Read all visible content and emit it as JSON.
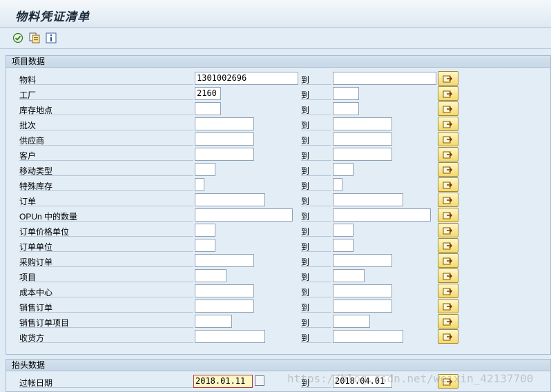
{
  "title": "物料凭证清单",
  "toolbar": {
    "execute": "execute-icon",
    "variants": "variants-icon",
    "info": "info-icon"
  },
  "item_group": {
    "title": "项目数据",
    "to_label": "到",
    "rows": [
      {
        "label": "物料",
        "from": "1301002696",
        "to": ""
      },
      {
        "label": "工厂",
        "from": "2160",
        "to": ""
      },
      {
        "label": "库存地点",
        "from": "",
        "to": ""
      },
      {
        "label": "批次",
        "from": "",
        "to": ""
      },
      {
        "label": "供应商",
        "from": "",
        "to": ""
      },
      {
        "label": "客户",
        "from": "",
        "to": ""
      },
      {
        "label": "移动类型",
        "from": "",
        "to": ""
      },
      {
        "label": "特殊库存",
        "from": "",
        "to": ""
      },
      {
        "label": "订单",
        "from": "",
        "to": ""
      },
      {
        "label": "OPUn 中的数量",
        "from": "",
        "to": ""
      },
      {
        "label": "订单价格单位",
        "from": "",
        "to": ""
      },
      {
        "label": "订单单位",
        "from": "",
        "to": ""
      },
      {
        "label": "采购订单",
        "from": "",
        "to": ""
      },
      {
        "label": "项目",
        "from": "",
        "to": ""
      },
      {
        "label": "成本中心",
        "from": "",
        "to": ""
      },
      {
        "label": "销售订单",
        "from": "",
        "to": ""
      },
      {
        "label": "销售订单项目",
        "from": "",
        "to": ""
      },
      {
        "label": "收货方",
        "from": "",
        "to": ""
      }
    ]
  },
  "header_group": {
    "title": "抬头数据",
    "to_label": "到",
    "posting_date": {
      "label": "过帐日期",
      "from": "2018.01.11",
      "to": "2018.04.01"
    }
  },
  "watermark": "https://blog.csdn.net/weixin_42137700",
  "colors": {
    "background": "#dfebf5",
    "multi_button": "#f6d96b",
    "date_highlight": "#fff6c6"
  }
}
